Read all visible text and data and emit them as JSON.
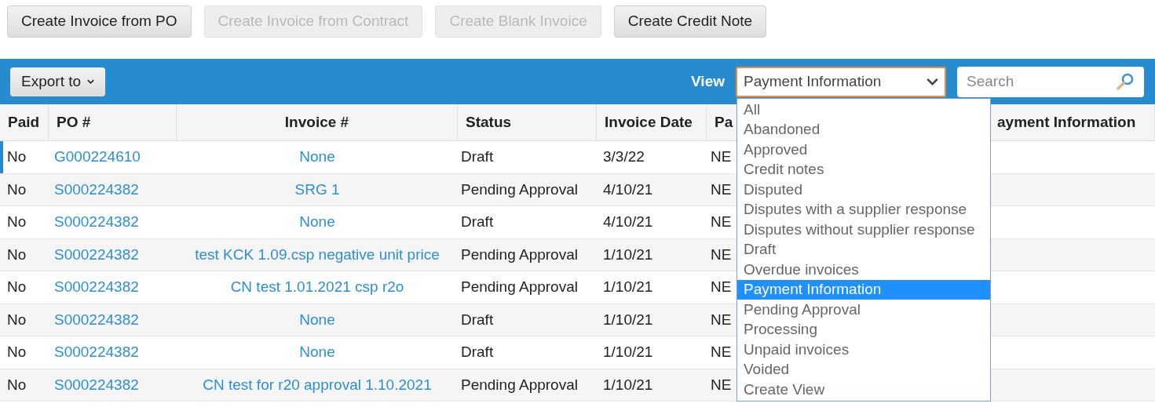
{
  "actions": [
    {
      "label": "Create Invoice from PO",
      "disabled": false
    },
    {
      "label": "Create Invoice from Contract",
      "disabled": true
    },
    {
      "label": "Create Blank Invoice",
      "disabled": true
    },
    {
      "label": "Create Credit Note",
      "disabled": false
    }
  ],
  "toolbar": {
    "export": "Export to",
    "view_label": "View",
    "view_value": "Payment Information",
    "search": {
      "placeholder": "Search"
    }
  },
  "view_menu": [
    {
      "label": "All",
      "selected": false
    },
    {
      "label": "Abandoned",
      "selected": false
    },
    {
      "label": "Approved",
      "selected": false
    },
    {
      "label": "Credit notes",
      "selected": false
    },
    {
      "label": "Disputed",
      "selected": false
    },
    {
      "label": "Disputes with a supplier response",
      "selected": false
    },
    {
      "label": "Disputes without supplier response",
      "selected": false
    },
    {
      "label": "Draft",
      "selected": false
    },
    {
      "label": "Overdue invoices",
      "selected": false
    },
    {
      "label": "Payment Information",
      "selected": true
    },
    {
      "label": "Pending Approval",
      "selected": false
    },
    {
      "label": "Processing",
      "selected": false
    },
    {
      "label": "Unpaid invoices",
      "selected": false
    },
    {
      "label": "Voided",
      "selected": false
    },
    {
      "label": "Create View",
      "selected": false
    }
  ],
  "table": {
    "columns": [
      "Paid",
      "PO #",
      "Invoice #",
      "Status",
      "Invoice Date",
      "Pa",
      "ayment Information"
    ],
    "rows": [
      {
        "paid": "No",
        "po": "G000224610",
        "invoice": "None",
        "status": "Draft",
        "date": "3/3/22",
        "column_6": "NE",
        "selected": true
      },
      {
        "paid": "No",
        "po": "S000224382",
        "invoice": "SRG 1",
        "status": "Pending Approval",
        "date": "4/10/21",
        "column_6": "NE",
        "selected": false
      },
      {
        "paid": "No",
        "po": "S000224382",
        "invoice": "None",
        "status": "Draft",
        "date": "4/10/21",
        "column_6": "NE",
        "selected": false
      },
      {
        "paid": "No",
        "po": "S000224382",
        "invoice": "test KCK 1.09.csp negative unit price",
        "status": "Pending Approval",
        "date": "1/10/21",
        "column_6": "NE",
        "selected": false
      },
      {
        "paid": "No",
        "po": "S000224382",
        "invoice": "CN test 1.01.2021 csp r2o",
        "status": "Pending Approval",
        "date": "1/10/21",
        "column_6": "NE",
        "selected": false
      },
      {
        "paid": "No",
        "po": "S000224382",
        "invoice": "None",
        "status": "Draft",
        "date": "1/10/21",
        "column_6": "NE",
        "selected": false
      },
      {
        "paid": "No",
        "po": "S000224382",
        "invoice": "None",
        "status": "Draft",
        "date": "1/10/21",
        "column_6": "NE",
        "selected": false
      },
      {
        "paid": "No",
        "po": "S000224382",
        "invoice": "CN test for r20 approval 1.10.2021",
        "status": "Pending Approval",
        "date": "1/10/21",
        "column_6": "NE",
        "selected": false
      }
    ]
  }
}
